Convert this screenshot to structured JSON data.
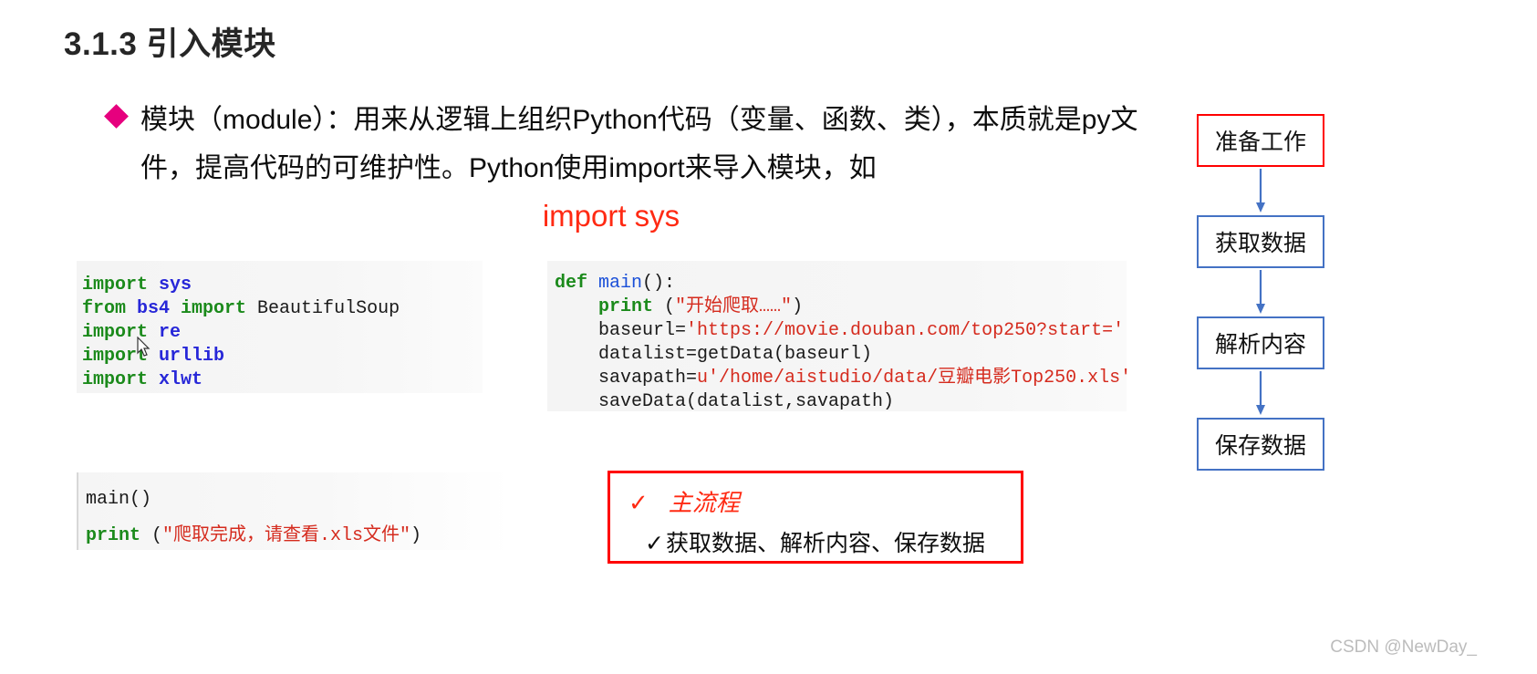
{
  "slide": {
    "title": "3.1.3 引入模块",
    "bullet": {
      "marker": "diamond-bullet",
      "text": "模块（module）：用来从逻辑上组织Python代码（变量、函数、类），本质就是py文件，提高代码的可维护性。Python使用import来导入模块，如"
    },
    "highlight_code": "import sys",
    "accent_colors": {
      "bullet": "#E6007E",
      "red": "#FF2A13",
      "box_border": "#FF0000",
      "flow_blue": "#4472C4",
      "flow_red": "#FF0000"
    }
  },
  "code_imports": {
    "name": "import-statements",
    "lines": [
      {
        "kw": "import",
        "mod": " sys",
        "rest": ""
      },
      {
        "kw": "from",
        "mod": " bs4 ",
        "kw2": "import",
        "rest": " BeautifulSoup"
      },
      {
        "kw": "import",
        "mod": " re",
        "rest": ""
      },
      {
        "kw": "import",
        "mod": " urllib",
        "rest": ""
      },
      {
        "kw": "import",
        "mod": " xlwt",
        "rest": ""
      }
    ]
  },
  "code_main": {
    "name": "main-function",
    "line1_kw": "def",
    "line1_fn": " main",
    "line1_rest": "():",
    "line2_fn": "    print",
    "line2_paren_open": " (",
    "line2_str": "\"开始爬取……\"",
    "line2_paren_close": ")",
    "line3_plain": "    baseurl=",
    "line3_str": "'https://movie.douban.com/top250?start='",
    "line4_plain": "    datalist=getData(baseurl)",
    "line5_plain": "    savapath=",
    "line5_str": "u'/home/aistudio/data/豆瓣电影Top250.xls'",
    "line6_plain": "    saveData(datalist,savapath)"
  },
  "code_run": {
    "name": "run-main",
    "line1": "main()",
    "line2_fn": "print",
    "line2_paren_open": " (",
    "line2_str": "\"爬取完成，请查看.xls文件\"",
    "line2_paren_close": ")"
  },
  "red_box": {
    "tick": "✓",
    "heading": "主流程",
    "tick2": "✓",
    "detail": "获取数据、解析内容、保存数据"
  },
  "flowchart": {
    "nodes": [
      {
        "label": "准备工作",
        "style": "red"
      },
      {
        "label": "获取数据",
        "style": "blue"
      },
      {
        "label": "解析内容",
        "style": "blue"
      },
      {
        "label": "保存数据",
        "style": "blue"
      }
    ],
    "arrow_color": "#4472C4"
  },
  "watermark": "CSDN @NewDay_"
}
